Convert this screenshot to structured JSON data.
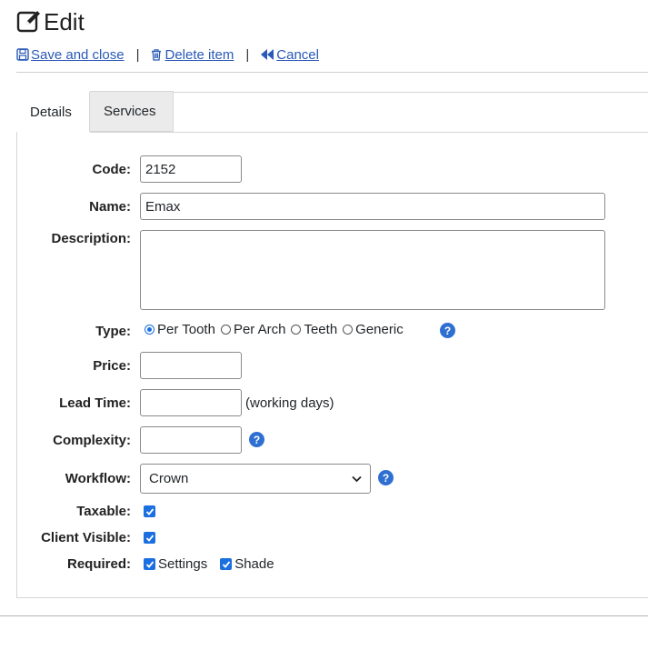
{
  "page": {
    "title": "Edit",
    "title_icon": "edit-icon"
  },
  "actions": [
    {
      "label": "Save and close",
      "icon": "save-icon"
    },
    {
      "label": "Delete item",
      "icon": "trash-icon"
    },
    {
      "label": "Cancel",
      "icon": "backward-icon"
    }
  ],
  "separator": "|",
  "tabs": [
    {
      "label": "Details",
      "active": true
    },
    {
      "label": "Services",
      "active": false
    }
  ],
  "form": {
    "code": {
      "label": "Code:",
      "value": "2152"
    },
    "name": {
      "label": "Name:",
      "value": "Emax"
    },
    "description": {
      "label": "Description:",
      "value": ""
    },
    "type": {
      "label": "Type:",
      "options": [
        "Per Tooth",
        "Per Arch",
        "Teeth",
        "Generic"
      ],
      "selected": "Per Tooth"
    },
    "price": {
      "label": "Price:",
      "value": ""
    },
    "lead_time": {
      "label": "Lead Time:",
      "value": "",
      "suffix": "(working days)"
    },
    "complexity": {
      "label": "Complexity:",
      "value": ""
    },
    "workflow": {
      "label": "Workflow:",
      "value": "Crown"
    },
    "taxable": {
      "label": "Taxable:",
      "checked": true
    },
    "client_visible": {
      "label": "Client Visible:",
      "checked": true
    },
    "required": {
      "label": "Required:",
      "options": [
        {
          "label": "Settings",
          "checked": true
        },
        {
          "label": "Shade",
          "checked": true
        }
      ]
    }
  },
  "colors": {
    "link": "#2a59b8",
    "accent": "#1b6fe0",
    "help": "#2f6fd1"
  }
}
